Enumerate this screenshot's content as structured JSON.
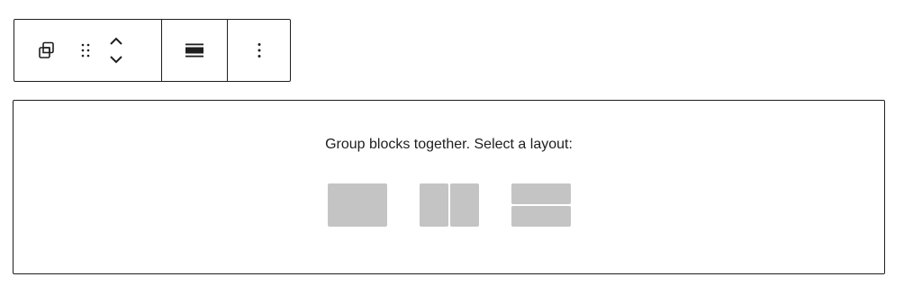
{
  "toolbar": {
    "buttons": [
      {
        "name": "group-icon"
      },
      {
        "name": "drag-handle-icon"
      },
      {
        "name": "move-up-icon"
      },
      {
        "name": "move-down-icon"
      },
      {
        "name": "align-icon"
      },
      {
        "name": "more-options-icon"
      }
    ]
  },
  "placeholder": {
    "label": "Group blocks together. Select a layout:",
    "variations": [
      {
        "name": "layout-group-icon"
      },
      {
        "name": "layout-row-icon"
      },
      {
        "name": "layout-stack-icon"
      }
    ],
    "tile_color": "#c4c4c4",
    "divider_color": "#ffffff"
  },
  "colors": {
    "border": "#1e1e1e",
    "text": "#1e1e1e",
    "background": "#ffffff"
  }
}
